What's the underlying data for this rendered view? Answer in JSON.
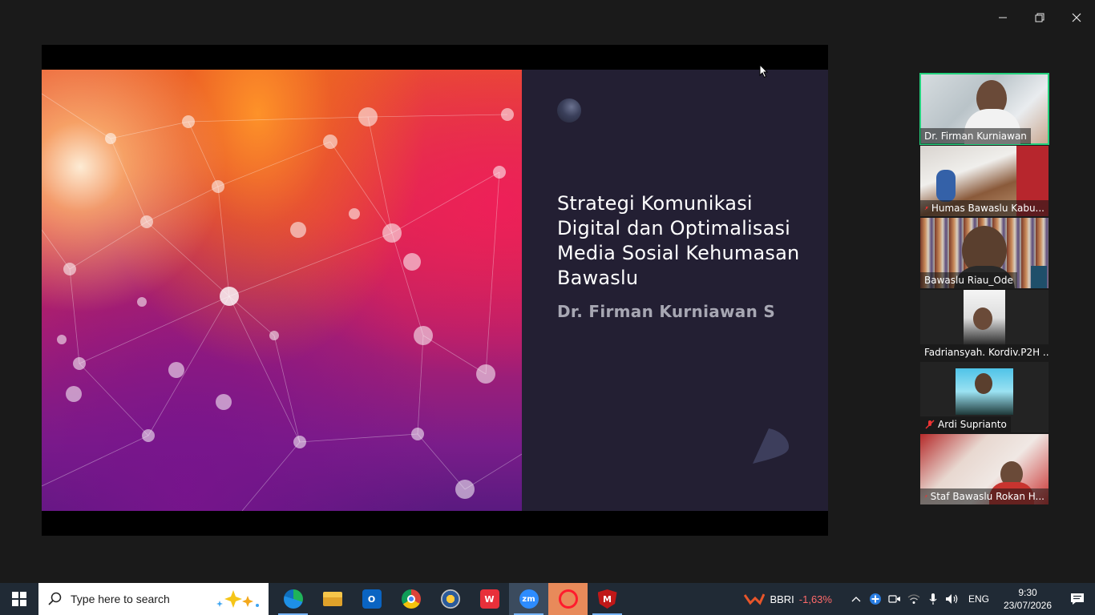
{
  "window": {
    "minimize_icon": "minimize-icon",
    "restore_icon": "restore-icon",
    "close_icon": "close-icon"
  },
  "slide": {
    "title": "Strategi Komunikasi Digital dan Optimalisasi Media Sosial Kehumasan Bawaslu",
    "author": "Dr. Firman Kurniawan S",
    "colors": {
      "panel": "#231f33",
      "author": "#a7a7b3"
    }
  },
  "participants": [
    {
      "name": "Dr. Firman Kurniawan",
      "muted": false,
      "active": true
    },
    {
      "name": "Humas Bawaslu Kabu...",
      "muted": true,
      "active": false
    },
    {
      "name": "Bawaslu Riau_Ode",
      "muted": false,
      "active": false
    },
    {
      "name": "Fadriansyah. Kordiv.P2H ...",
      "muted": false,
      "active": false
    },
    {
      "name": "Ardi Suprianto",
      "muted": true,
      "active": false
    },
    {
      "name": "Staf Bawaslu Rokan H...",
      "muted": true,
      "active": false
    }
  ],
  "taskbar": {
    "search_placeholder": "Type here to search",
    "apps": [
      "edge-icon",
      "file-explorer-icon",
      "outlook-icon",
      "chrome-icon",
      "photos-icon",
      "wps-icon",
      "zoom-icon",
      "opera-icon",
      "mcafee-icon"
    ],
    "stock": {
      "ticker": "BBRI",
      "change": "-1,63%"
    },
    "language": "ENG",
    "time": "9:30",
    "date": "23/07/2026"
  }
}
